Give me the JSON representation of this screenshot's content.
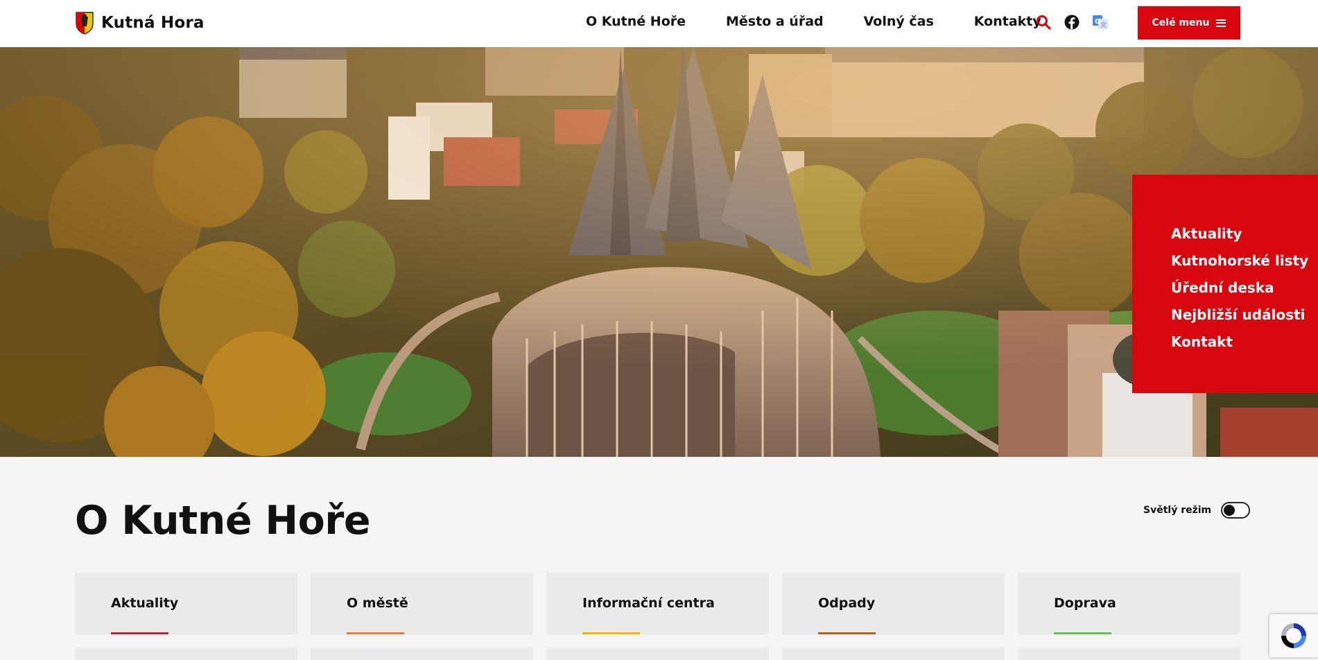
{
  "header": {
    "brand": "Kutná Hora",
    "nav": [
      "O Kutné Hoře",
      "Město a úřad",
      "Volný čas",
      "Kontakty"
    ],
    "menu_label": "Celé menu",
    "accent_color": "#d7060f"
  },
  "hero": {
    "quick_links": [
      "Aktuality",
      "Kutnohorské listy",
      "Úřední deska",
      "Nejbližší události",
      "Kontakt"
    ]
  },
  "main": {
    "title": "O Kutné Hoře",
    "mode_label": "Světlý režim",
    "cards": [
      {
        "label": "Aktuality",
        "color": "#b6243f"
      },
      {
        "label": "O městě",
        "color": "#e87a3c"
      },
      {
        "label": "Informační centra",
        "color": "#f2b705"
      },
      {
        "label": "Odpady",
        "color": "#a8671f"
      },
      {
        "label": "Doprava",
        "color": "#6cbf4e"
      }
    ]
  },
  "icons": {
    "search": "search-icon",
    "facebook": "facebook-icon",
    "translate": "translate-icon",
    "menu": "hamburger-icon",
    "recaptcha": "recaptcha-icon"
  }
}
